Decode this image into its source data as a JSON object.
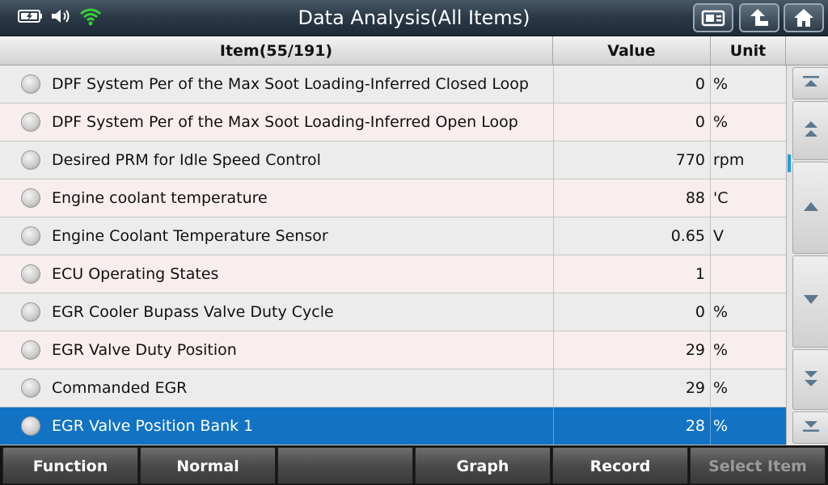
{
  "header": {
    "title": "Data Analysis(All Items)",
    "icons": [
      "battery-charging-icon",
      "speaker-icon",
      "wifi-icon"
    ],
    "buttons": [
      "screenshot-icon",
      "back-icon",
      "home-icon"
    ]
  },
  "table": {
    "headers": {
      "item": "Item(55/191)",
      "value": "Value",
      "unit": "Unit"
    },
    "rows": [
      {
        "name": "DPF System Per of the Max Soot Loading-Inferred Closed Loop",
        "value": "0",
        "unit": "%"
      },
      {
        "name": "DPF System Per of the Max Soot Loading-Inferred Open Loop",
        "value": "0",
        "unit": "%"
      },
      {
        "name": "Desired PRM for Idle Speed Control",
        "value": "770",
        "unit": "rpm"
      },
      {
        "name": "Engine coolant temperature",
        "value": "88",
        "unit": "'C"
      },
      {
        "name": "Engine Coolant Temperature Sensor",
        "value": "0.65",
        "unit": "V"
      },
      {
        "name": "ECU Operating States",
        "value": "1",
        "unit": ""
      },
      {
        "name": "EGR Cooler Bupass Valve Duty Cycle",
        "value": "0",
        "unit": "%"
      },
      {
        "name": "EGR Valve Duty Position",
        "value": "29",
        "unit": "%"
      },
      {
        "name": "Commanded EGR",
        "value": "29",
        "unit": "%"
      },
      {
        "name": "EGR Valve Position Bank 1",
        "value": "28",
        "unit": "%",
        "selected": true
      }
    ]
  },
  "scroll_buttons": [
    "scroll-top-icon",
    "page-up-icon",
    "scroll-up-icon",
    "scroll-down-icon",
    "page-down-icon",
    "scroll-bottom-icon"
  ],
  "footer": {
    "buttons": [
      {
        "label": "Function",
        "enabled": true
      },
      {
        "label": "Normal",
        "enabled": true
      },
      {
        "label": "",
        "enabled": true
      },
      {
        "label": "Graph",
        "enabled": true
      },
      {
        "label": "Record",
        "enabled": true
      },
      {
        "label": "Select Item",
        "enabled": false
      }
    ]
  },
  "colors": {
    "selected_row": "#1273c4",
    "wifi": "#35d435",
    "scroll_indicator": "#1e9be8"
  }
}
